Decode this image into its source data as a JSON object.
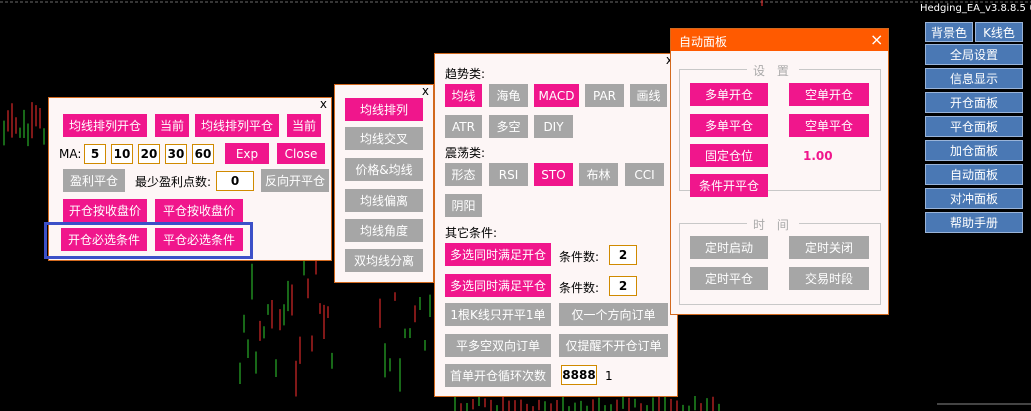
{
  "header": {
    "version": "Hedging_EA_v3.8.8.5"
  },
  "ma_panel": {
    "close": "x",
    "ma_align_open": "均线排列开仓",
    "current1": "当前",
    "ma_align_close": "均线排列平仓",
    "current2": "当前",
    "ma_label": "MA:",
    "ma_values": [
      "5",
      "10",
      "20",
      "30",
      "60"
    ],
    "exp": "Exp",
    "close_btn": "Close",
    "profit_close": "盈利平仓",
    "min_profit_label": "最少盈利点数:",
    "min_profit_value": "0",
    "reverse_open": "反向开平仓",
    "open_by_close": "开仓按收盘价",
    "close_by_close": "平仓按收盘价",
    "open_required": "开仓必选条件",
    "close_required": "平仓必选条件"
  },
  "ma_list_panel": {
    "close": "x",
    "items": [
      "均线排列",
      "均线交叉",
      "价格&均线",
      "均线偏离",
      "均线角度",
      "双均线分离"
    ]
  },
  "indicator_panel": {
    "close": "x",
    "trend_title": "趋势类:",
    "trend_row1": [
      "均线",
      "海龟",
      "MACD",
      "PAR",
      "画线"
    ],
    "trend_row2": [
      "ATR",
      "多空",
      "DIY"
    ],
    "osc_title": "震荡类:",
    "osc_row1": [
      "形态",
      "RSI",
      "STO",
      "布林",
      "CCI"
    ],
    "osc_row2": [
      "阴阳"
    ],
    "other_title": "其它条件:",
    "multi_open": "多选同时满足开仓",
    "multi_open_count_label": "条件数:",
    "multi_open_count": "2",
    "multi_close": "多选同时满足平仓",
    "multi_close_count_label": "条件数:",
    "multi_close_count": "2",
    "one_bar_once": "1根K线只开平1单",
    "one_direction": "仅一个方向订单",
    "flat_both": "平多空双向订单",
    "alert_only": "仅提醒不开仓订单",
    "first_loop": "首单开仓循环次数",
    "loop_value": "8888",
    "loop_extra": "1"
  },
  "auto_panel": {
    "title": "自动面板",
    "close": "×",
    "settings_title": "设 置",
    "buy_open": "多单开仓",
    "sell_open": "空单开仓",
    "buy_close": "多单平仓",
    "sell_close": "空单平仓",
    "fixed_lot": "固定仓位",
    "lot_value": "1.00",
    "cond_open": "条件开平仓",
    "time_title": "时 间",
    "timed_start": "定时启动",
    "timed_stop": "定时关闭",
    "timed_close": "定时平仓",
    "trade_period": "交易时段"
  },
  "right_menu": {
    "bg_color": "背景色",
    "k_color": "K线色",
    "items": [
      "全局设置",
      "信息显示",
      "开仓面板",
      "平仓面板",
      "加仓面板",
      "自动面板",
      "对冲面板",
      "帮助手册"
    ]
  },
  "colors": {
    "accent": "#f0168c",
    "inactive": "#a6a6a6",
    "title_bar": "#ff5a00",
    "menu": "#4a78b4",
    "highlight_box": "#3c50c8"
  }
}
